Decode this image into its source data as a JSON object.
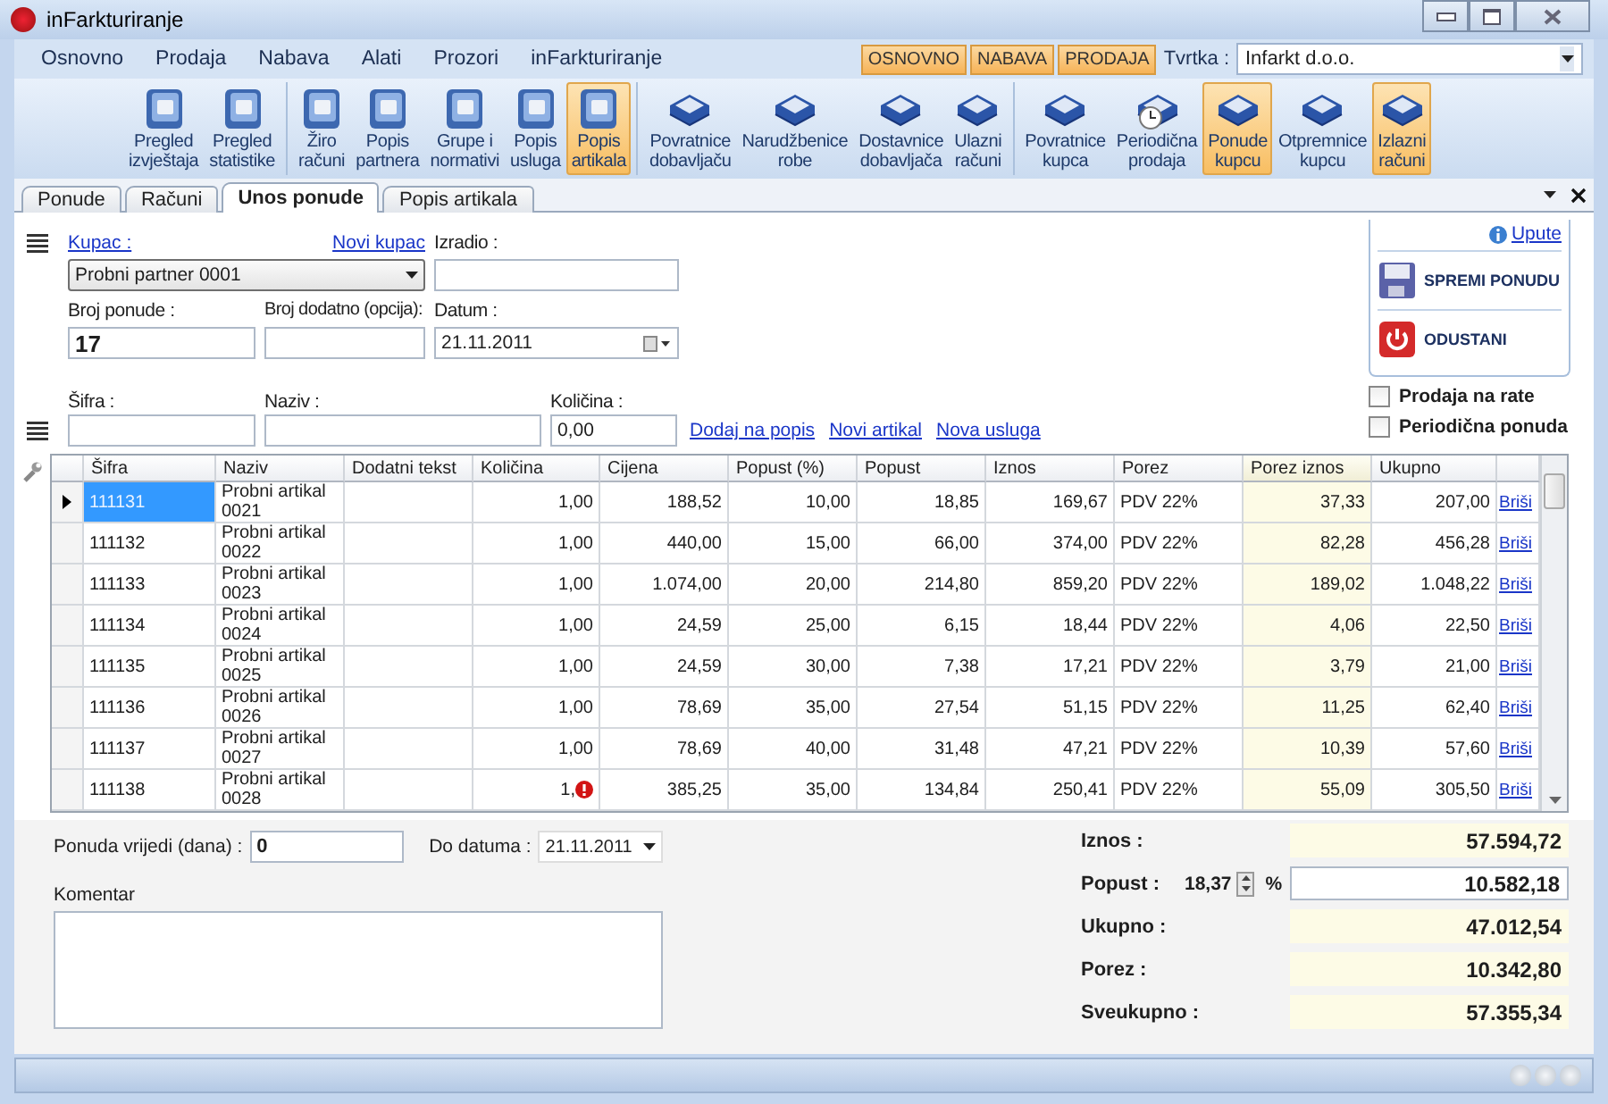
{
  "window": {
    "title": "inFarkturiranje"
  },
  "menu": [
    "Osnovno",
    "Prodaja",
    "Nabava",
    "Alati",
    "Prozori",
    "inFarkturiranje"
  ],
  "mode_buttons": [
    "OSNOVNO",
    "NABAVA",
    "PRODAJA"
  ],
  "company": {
    "label": "Tvrtka :",
    "value": "Infarkt d.o.o."
  },
  "toolbar": [
    {
      "items": [
        {
          "label": "Pregled\nizvještaja",
          "kind": "book",
          "selected": false
        },
        {
          "label": "Pregled\nstatistike",
          "kind": "book",
          "selected": false
        }
      ]
    },
    {
      "items": [
        {
          "label": "Žiro\nračuni",
          "kind": "book",
          "selected": false
        },
        {
          "label": "Popis\npartnera",
          "kind": "book",
          "selected": false
        },
        {
          "label": "Grupe i\nnormativi",
          "kind": "book",
          "selected": false
        },
        {
          "label": "Popis\nusluga",
          "kind": "book",
          "selected": false
        },
        {
          "label": "Popis\nartikala",
          "kind": "book",
          "selected": true
        }
      ]
    },
    {
      "items": [
        {
          "label": "Povratnice\ndobavljaču",
          "kind": "tray",
          "selected": false
        },
        {
          "label": "Narudžbenice\nrobe",
          "kind": "tray",
          "selected": false
        },
        {
          "label": "Dostavnice\ndobavljača",
          "kind": "tray",
          "selected": false
        },
        {
          "label": "Ulazni\nračuni",
          "kind": "tray",
          "selected": false
        }
      ]
    },
    {
      "items": [
        {
          "label": "Povratnice\nkupca",
          "kind": "tray",
          "selected": false
        },
        {
          "label": "Periodična\nprodaja",
          "kind": "tray-clock",
          "selected": false
        },
        {
          "label": "Ponude\nkupcu",
          "kind": "tray",
          "selected": true
        },
        {
          "label": "Otpremnice\nkupcu",
          "kind": "tray",
          "selected": false
        },
        {
          "label": "Izlazni\nračuni",
          "kind": "tray",
          "selected": true
        }
      ]
    }
  ],
  "tabs": [
    {
      "label": "Ponude",
      "selected": false
    },
    {
      "label": "Računi",
      "selected": false
    },
    {
      "label": "Unos ponude",
      "selected": true
    },
    {
      "label": "Popis artikala",
      "selected": false
    }
  ],
  "form": {
    "customer_link": "Kupac :",
    "new_customer_link": "Novi kupac",
    "customer": "Probni partner 0001",
    "created_by_label": "Izradio :",
    "number_label": "Broj ponude :",
    "number": "17",
    "extra_number_label": "Broj dodatno (opcija):",
    "date_label": "Datum :",
    "date": "21.11.2011"
  },
  "item_entry": {
    "code_label": "Šifra :",
    "name_label": "Naziv :",
    "quantity_label": "Količina :",
    "quantity": "0,00",
    "links": [
      "Dodaj na popis",
      "Novi artikal",
      "Nova usluga"
    ]
  },
  "side_panel": {
    "help_link": "Upute",
    "buttons": [
      {
        "label": "SPREMI PONUDU",
        "kind": "save"
      },
      {
        "label": "ODUSTANI",
        "kind": "cancel"
      }
    ]
  },
  "options": [
    {
      "label": "Prodaja na rate",
      "checked": false
    },
    {
      "label": "Periodična ponuda",
      "checked": false
    }
  ],
  "grid": {
    "columns": [
      {
        "label": "Šifra",
        "kind": "text",
        "shaded": false
      },
      {
        "label": "Naziv",
        "kind": "text",
        "shaded": false
      },
      {
        "label": "Dodatni tekst",
        "kind": "text",
        "shaded": false
      },
      {
        "label": "Količina",
        "kind": "number",
        "shaded": false
      },
      {
        "label": "Cijena",
        "kind": "number",
        "shaded": false
      },
      {
        "label": "Popust (%)",
        "kind": "number",
        "shaded": false
      },
      {
        "label": "Popust",
        "kind": "number",
        "shaded": false
      },
      {
        "label": "Iznos",
        "kind": "number",
        "shaded": false
      },
      {
        "label": "Porez",
        "kind": "text",
        "shaded": false
      },
      {
        "label": "Porez iznos",
        "kind": "number",
        "shaded": true
      },
      {
        "label": "Ukupno",
        "kind": "number",
        "shaded": false
      },
      {
        "kind": "link",
        "shaded": false
      }
    ],
    "rows": [
      {
        "selected": true,
        "warning": false,
        "cells": [
          "111131",
          "Probni artikal 0021",
          null,
          "1,00",
          "188,52",
          "10,00",
          "18,85",
          "169,67",
          "PDV 22%",
          "37,33",
          "207,00",
          "Briši"
        ]
      },
      {
        "selected": false,
        "warning": false,
        "cells": [
          "111132",
          "Probni artikal 0022",
          null,
          "1,00",
          "440,00",
          "15,00",
          "66,00",
          "374,00",
          "PDV 22%",
          "82,28",
          "456,28",
          "Briši"
        ]
      },
      {
        "selected": false,
        "warning": false,
        "cells": [
          "111133",
          "Probni artikal 0023",
          null,
          "1,00",
          "1.074,00",
          "20,00",
          "214,80",
          "859,20",
          "PDV 22%",
          "189,02",
          "1.048,22",
          "Briši"
        ]
      },
      {
        "selected": false,
        "warning": false,
        "cells": [
          "111134",
          "Probni artikal 0024",
          null,
          "1,00",
          "24,59",
          "25,00",
          "6,15",
          "18,44",
          "PDV 22%",
          "4,06",
          "22,50",
          "Briši"
        ]
      },
      {
        "selected": false,
        "warning": false,
        "cells": [
          "111135",
          "Probni artikal 0025",
          null,
          "1,00",
          "24,59",
          "30,00",
          "7,38",
          "17,21",
          "PDV 22%",
          "3,79",
          "21,00",
          "Briši"
        ]
      },
      {
        "selected": false,
        "warning": false,
        "cells": [
          "111136",
          "Probni artikal 0026",
          null,
          "1,00",
          "78,69",
          "35,00",
          "27,54",
          "51,15",
          "PDV 22%",
          "11,25",
          "62,40",
          "Briši"
        ]
      },
      {
        "selected": false,
        "warning": false,
        "cells": [
          "111137",
          "Probni artikal 0027",
          null,
          "1,00",
          "78,69",
          "40,00",
          "31,48",
          "47,21",
          "PDV 22%",
          "10,39",
          "57,60",
          "Briši"
        ]
      },
      {
        "selected": false,
        "warning": true,
        "cells": [
          "111138",
          "Probni artikal 0028",
          null,
          "1,",
          "385,25",
          "35,00",
          "134,84",
          "250,41",
          "PDV 22%",
          "55,09",
          "305,50",
          "Briši"
        ]
      }
    ]
  },
  "validity": {
    "days_label": "Ponuda vrijedi (dana) :",
    "days": "0",
    "until_label": "Do datuma :",
    "until": "21.11.2011",
    "comment_label": "Komentar"
  },
  "totals": {
    "amount_label": "Iznos :",
    "amount": "57.594,72",
    "discount_label": "Popust :",
    "discount_percent": "18,37",
    "percent_sign": "%",
    "discount": "10.582,18",
    "subtotal_label": "Ukupno :",
    "subtotal": "47.012,54",
    "tax_label": "Porez :",
    "tax": "10.342,80",
    "total_label": "Sveukupno :",
    "total": "57.355,34"
  }
}
